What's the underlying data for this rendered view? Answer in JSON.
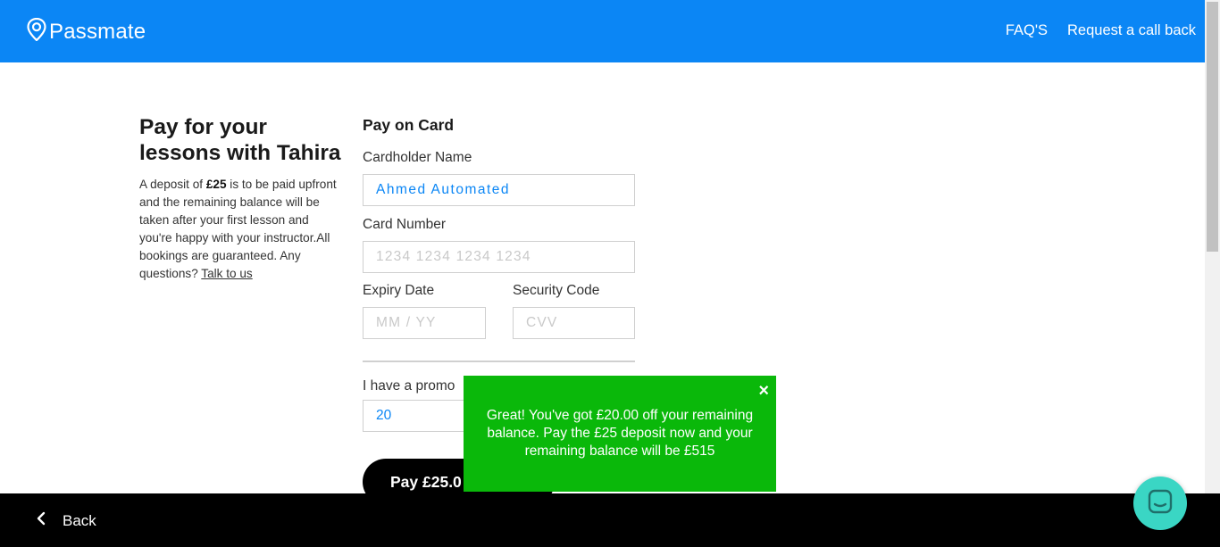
{
  "header": {
    "brand": "Passmate",
    "nav": {
      "faqs": "FAQ'S",
      "callback": "Request a call back"
    }
  },
  "intro": {
    "title": "Pay for your lessons with Tahira",
    "text_before": "A deposit of ",
    "deposit_amount": "£25",
    "text_after": " is to be paid upfront and the remaining balance will be taken after your first lesson and you're happy with your instructor.All bookings are guaranteed. Any questions? ",
    "link": "Talk to us"
  },
  "form": {
    "title": "Pay on Card",
    "cardholder_label": "Cardholder Name",
    "cardholder_value": "Ahmed Automated",
    "card_number_label": "Card Number",
    "card_number_placeholder": "1234 1234 1234 1234",
    "expiry_label": "Expiry Date",
    "expiry_placeholder": "MM / YY",
    "security_label": "Security Code",
    "security_placeholder": "CVV",
    "promo_label": "I have a promo",
    "promo_value": "20",
    "pay_button": "Pay £25.0"
  },
  "toast": {
    "message": "Great! You've got £20.00 off your remaining balance. Pay the £25 deposit now and your remaining balance will be £515",
    "close": "×"
  },
  "footer": {
    "back": "Back"
  },
  "icons": {
    "logo": "location-pin-icon",
    "back": "chevron-left-icon",
    "chat": "chat-bubble-icon",
    "close": "close-icon"
  },
  "colors": {
    "brand_blue": "#0b86f5",
    "toast_green": "#0ab80a",
    "chat_teal": "#3ad6c4"
  }
}
